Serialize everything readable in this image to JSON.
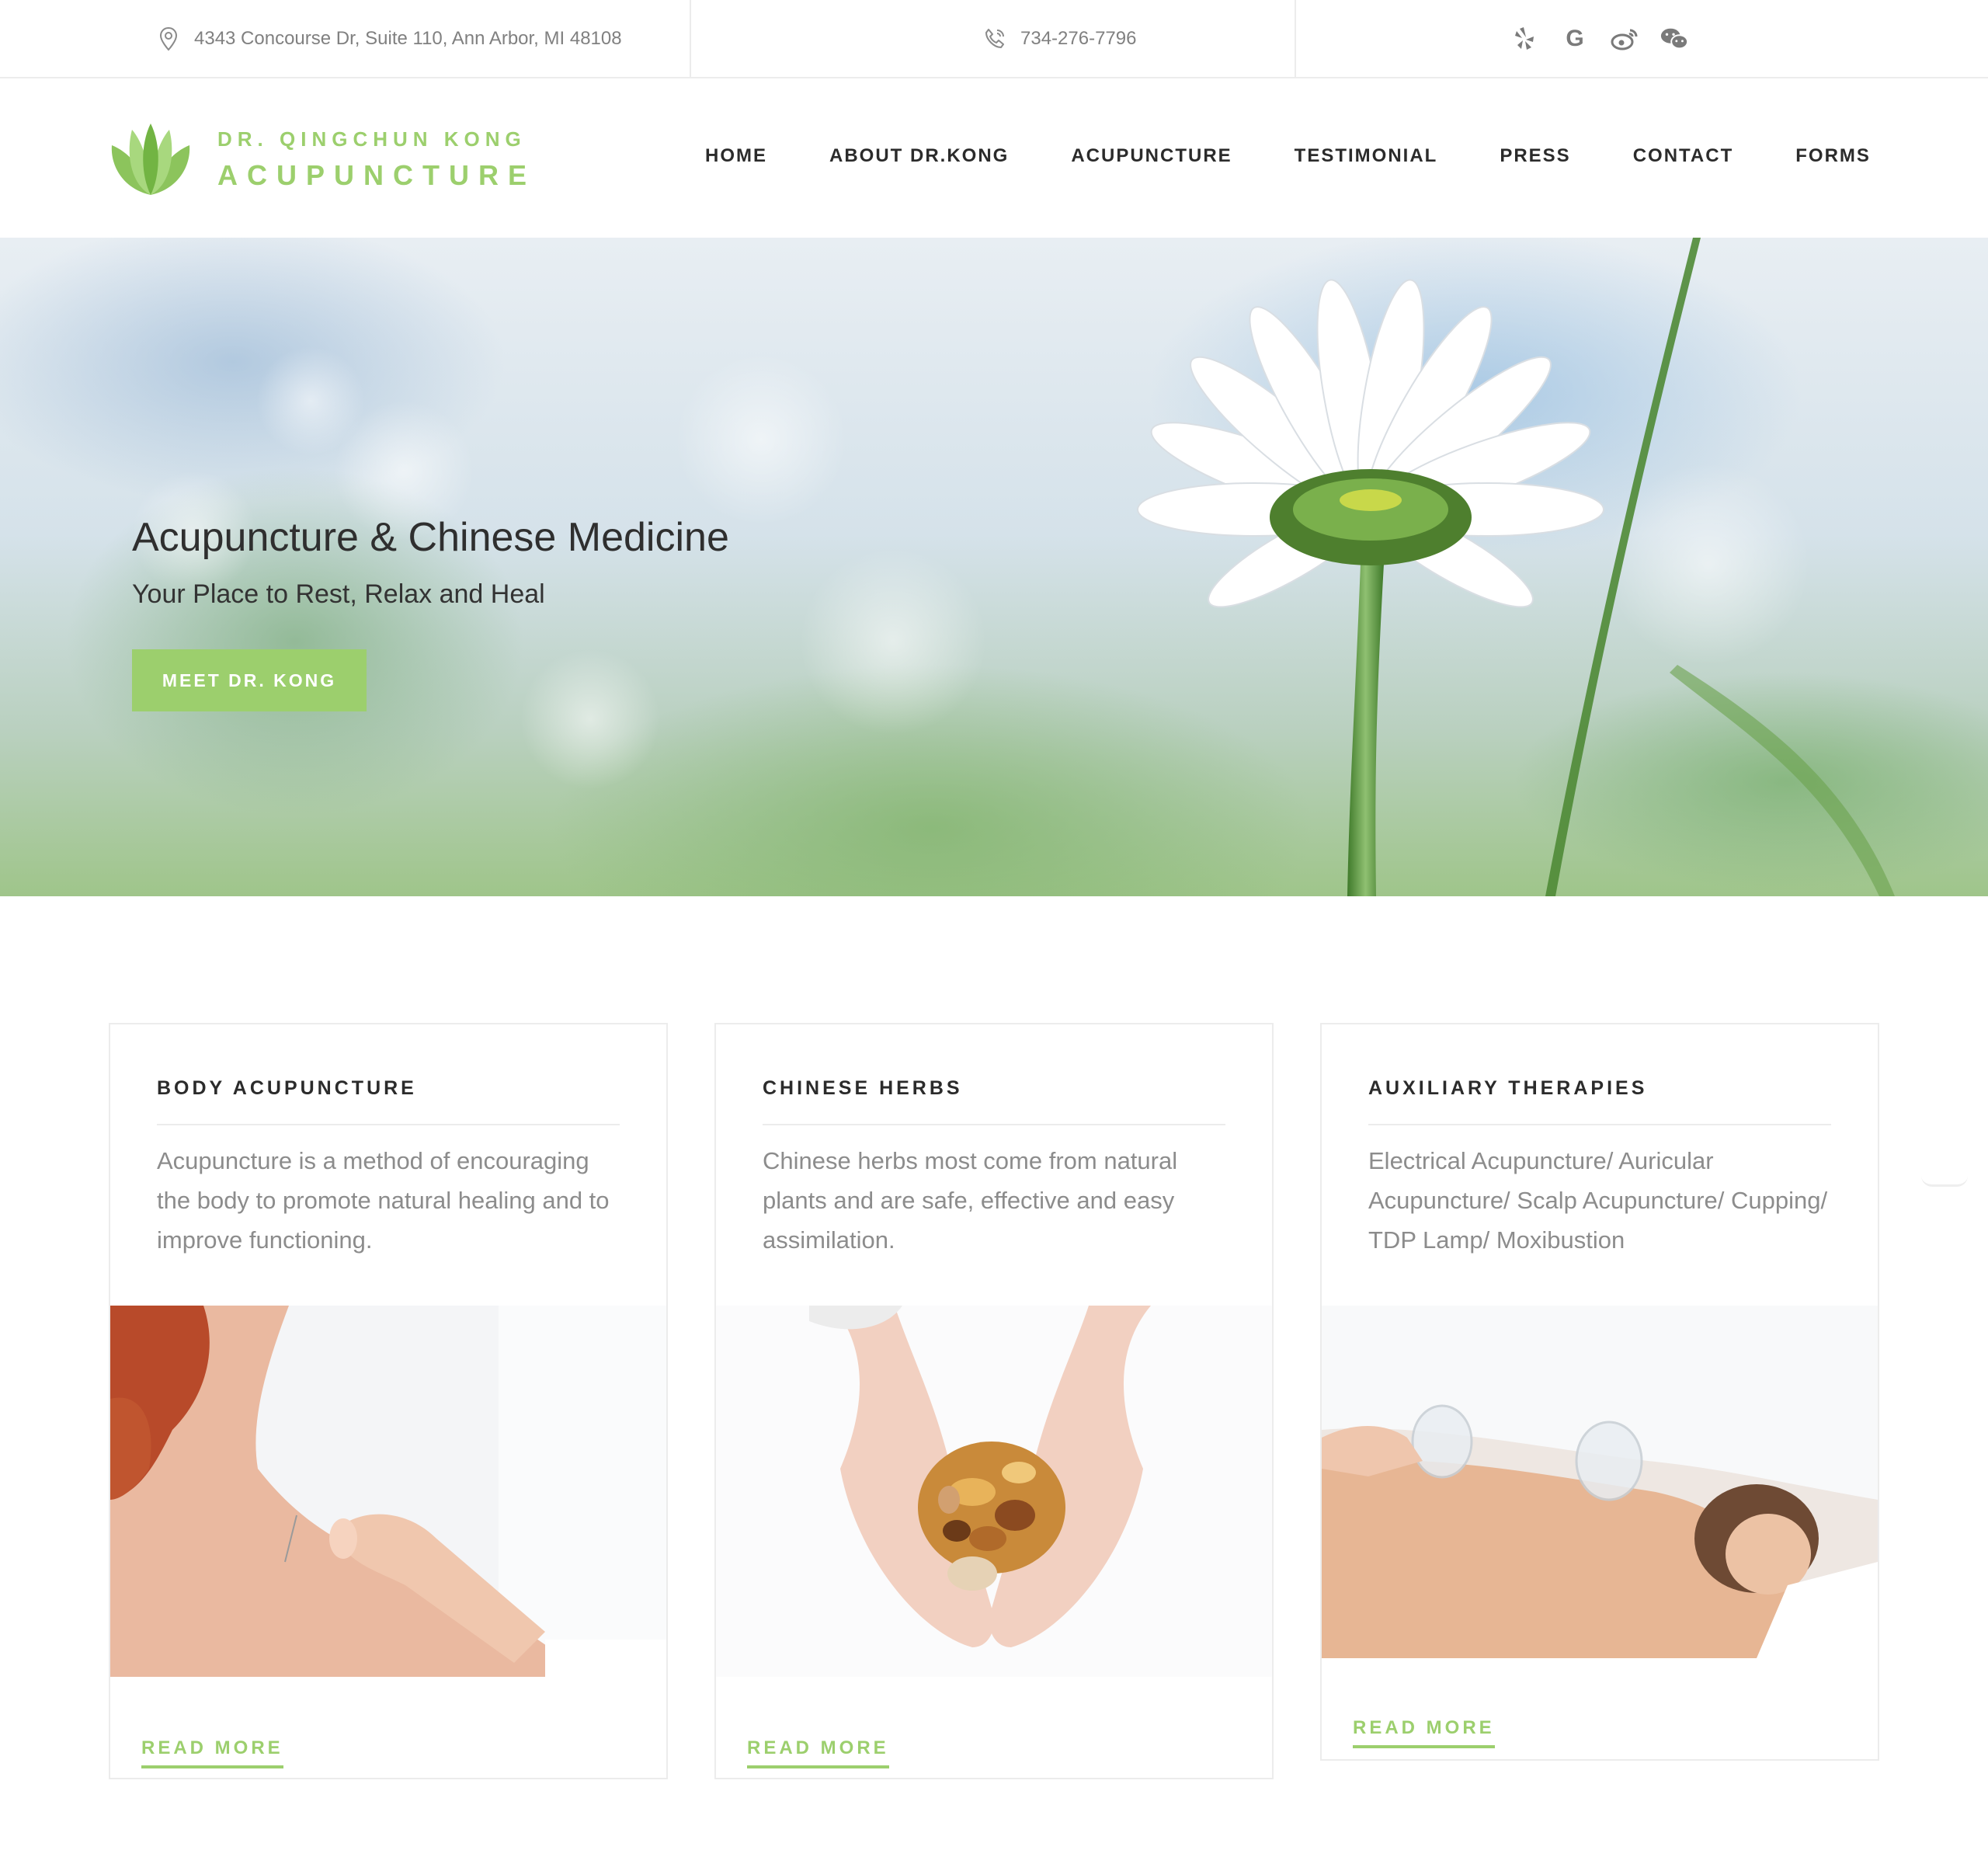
{
  "topbar": {
    "address": "4343 Concourse Dr, Suite 110, Ann Arbor, MI 48108",
    "phone": "734-276-7796",
    "social": [
      {
        "icon": "yelp-icon"
      },
      {
        "icon": "google-icon",
        "glyph": "G"
      },
      {
        "icon": "weibo-icon"
      },
      {
        "icon": "wechat-icon"
      }
    ]
  },
  "logo": {
    "line1": "DR. QINGCHUN KONG",
    "line2": "ACUPUNCTURE"
  },
  "nav": {
    "items": [
      "HOME",
      "ABOUT DR.KONG",
      "ACUPUNCTURE",
      "TESTIMONIAL",
      "PRESS",
      "CONTACT",
      "FORMS"
    ]
  },
  "hero": {
    "title": "Acupuncture & Chinese Medicine",
    "subtitle": "Your Place to Rest, Relax and Heal",
    "button": "MEET DR. KONG"
  },
  "cards": [
    {
      "title": "BODY ACUPUNCTURE",
      "description": "Acupuncture is a method of encouraging the body to promote natural healing and to improve functioning.",
      "link": "READ MORE"
    },
    {
      "title": "CHINESE HERBS",
      "description": "Chinese herbs most come from natural plants and are safe, effective and easy assimilation.",
      "link": "READ MORE"
    },
    {
      "title": "AUXILIARY THERAPIES",
      "description": "Electrical Acupuncture/ Auricular Acupuncture/ Scalp Acupuncture/ Cupping/ TDP Lamp/ Moxibustion",
      "link": "READ MORE"
    }
  ],
  "colors": {
    "accent": "#9ccf6d",
    "text_dark": "#2b2b2b",
    "text_muted": "#8c8c8c",
    "divider": "#ececec"
  }
}
